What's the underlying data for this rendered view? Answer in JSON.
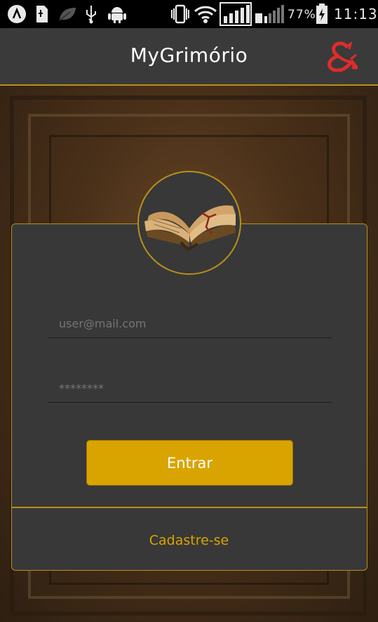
{
  "status_bar": {
    "battery_percent": "77%",
    "time": "11:13",
    "icons": [
      "app-a-icon",
      "sim-icon",
      "leaf-icon",
      "usb-icon",
      "android-icon",
      "vibrate-icon",
      "wifi-icon",
      "signal-icon",
      "signal-2-icon",
      "battery-charging-icon"
    ]
  },
  "app_bar": {
    "title": "MyGrimório",
    "logo_icon": "dnd-ampersand-icon",
    "logo_color": "#e02b2b",
    "background": "#3a3a3a",
    "accent": "#b8901a"
  },
  "login": {
    "avatar_icon": "open-book-icon",
    "email_placeholder": "user@mail.com",
    "password_value": "********",
    "submit_label": "Entrar",
    "register_label": "Cadastre-se",
    "button_color": "#d9a400"
  }
}
